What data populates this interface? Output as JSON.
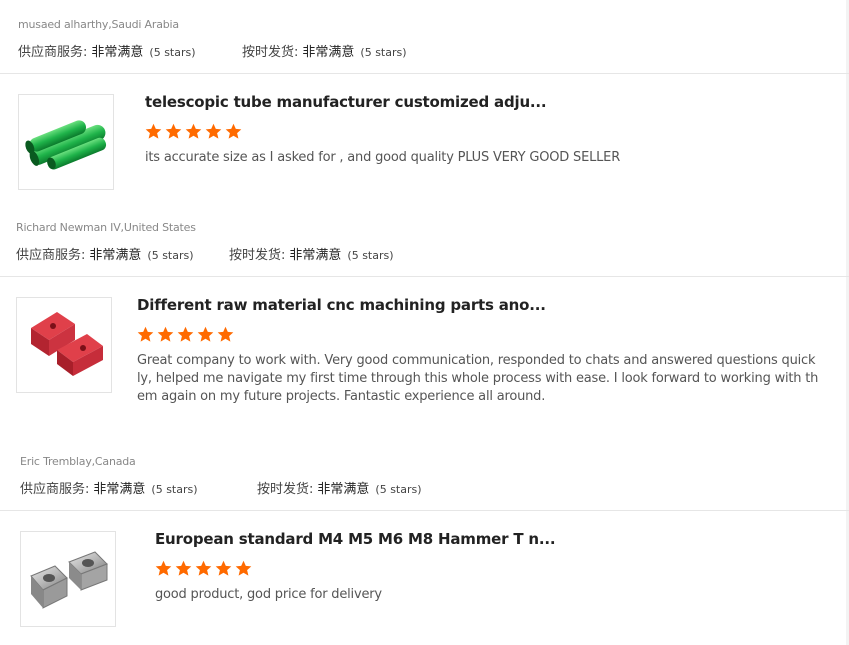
{
  "reviews": [
    {
      "reviewer": "musaed alharthy,Saudi Arabia",
      "supplier_label": "供应商服务:",
      "supplier_value": "非常满意",
      "supplier_stars": "(5 stars)",
      "delivery_label": "按时发货:",
      "delivery_value": "非常满意",
      "delivery_stars": "(5 stars)",
      "product_title": "telescopic tube manufacturer customized adju...",
      "rating": 5,
      "comment": "its accurate size as I asked for , and good quality PLUS VERY GOOD SELLER",
      "thumb_icon": "green-tube-image"
    },
    {
      "reviewer": "Richard Newman IV,United States",
      "supplier_label": "供应商服务:",
      "supplier_value": "非常满意",
      "supplier_stars": "(5 stars)",
      "delivery_label": "按时发货:",
      "delivery_value": "非常满意",
      "delivery_stars": "(5 stars)",
      "product_title": "Different raw material cnc machining parts ano...",
      "rating": 5,
      "comment_lines": [
        "Great company to work with. Very good communication, responded to chats and answered questions quick",
        "ly, helped me navigate my first time through this whole process with ease. I look forward to working with th",
        "em again on my future projects. Fantastic experience all around."
      ],
      "thumb_icon": "red-cnc-part-image"
    },
    {
      "reviewer": "Eric Tremblay,Canada",
      "supplier_label": "供应商服务:",
      "supplier_value": "非常满意",
      "supplier_stars": "(5 stars)",
      "delivery_label": "按时发货:",
      "delivery_value": "非常满意",
      "delivery_stars": "(5 stars)",
      "product_title": "European standard M4 M5 M6 M8 Hammer T n...",
      "rating": 5,
      "comment": "good product, god price for delivery",
      "thumb_icon": "hammer-t-nut-image"
    }
  ],
  "colors": {
    "star": "#ff6a00",
    "divider": "#e6e6e6"
  }
}
